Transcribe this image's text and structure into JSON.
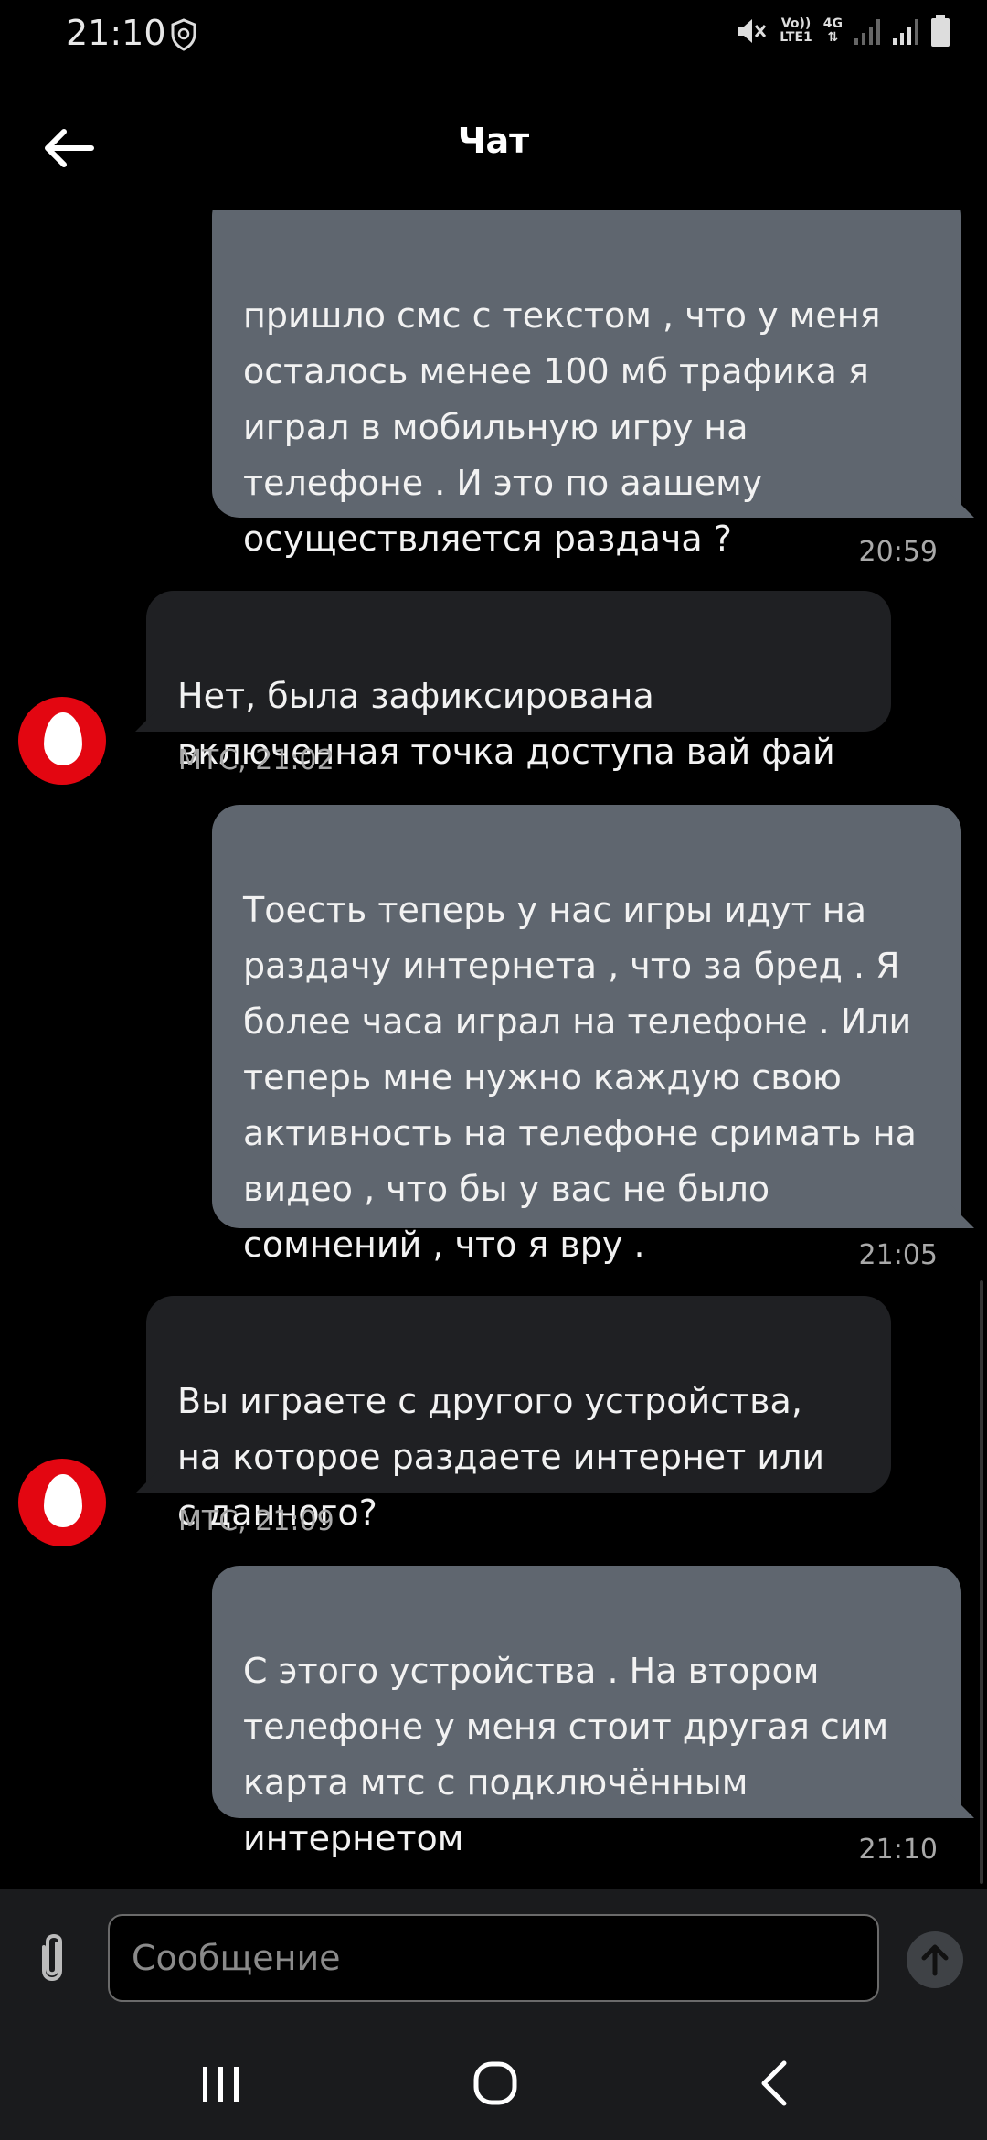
{
  "status_bar": {
    "time": "21:10",
    "volte_line1": "Vo))",
    "volte_line2": "LTE1",
    "network": "4G",
    "icons": [
      "shield-icon",
      "mute-icon",
      "signal-icon",
      "signal-icon",
      "battery-icon"
    ]
  },
  "header": {
    "title": "Чат",
    "back_icon": "arrow-left-icon"
  },
  "messages": [
    {
      "type": "outgoing",
      "text": "пришло смс с текстом , что у меня\nосталось менее 100 мб трафика я\nиграл в мобильную игру на\nтелефоне . И это по аашему\nосуществляется раздача ?",
      "time": "20:59"
    },
    {
      "type": "incoming",
      "text": "Нет, была зафиксирована\nвключенная точка доступа вай фай",
      "meta": "МТС, 21:02"
    },
    {
      "type": "outgoing",
      "text": "Тоесть теперь у нас игры идут на\nраздачу интернета , что за бред . Я\nболее часа играл на телефоне . Или\nтеперь мне нужно каждую свою\nактивность на телефоне сримать на\nвидео , что бы у вас не было\nсомнений , что я вру .",
      "time": "21:05"
    },
    {
      "type": "incoming",
      "text": "Вы играете с другого устройства,\nна которое раздаете интернет или\nс данного?",
      "meta": "МТС, 21:09"
    },
    {
      "type": "outgoing",
      "text": "С этого устройства . На втором\nтелефоне у меня стоит другая сим\nкарта мтс с подключённым\nинтернетом",
      "time": "21:10"
    }
  ],
  "input": {
    "placeholder": "Сообщение",
    "value": ""
  },
  "colors": {
    "outgoing_bubble": "#5f666f",
    "incoming_bubble": "#1f2023",
    "brand": "#e30611"
  }
}
